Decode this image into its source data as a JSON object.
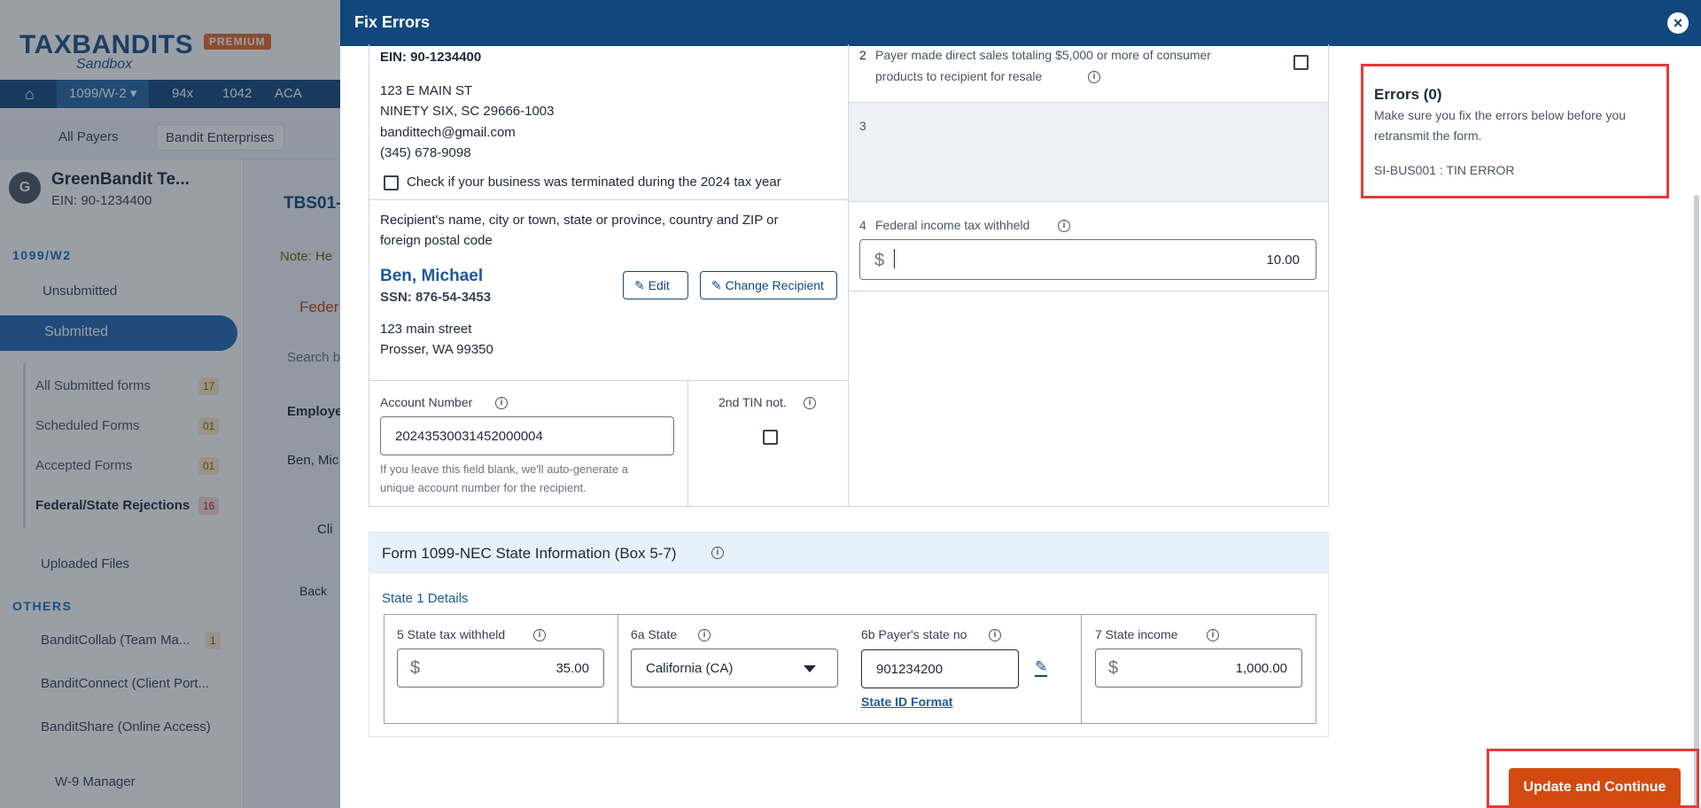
{
  "background": {
    "logo_text": "TAXBANDITS",
    "logo_sub": "Sandbox",
    "logo_badge": "PREMIUM",
    "nav": [
      "1099/W-2 ▾",
      "94x",
      "1042",
      "ACA"
    ],
    "filter_all_payers": "All Payers",
    "filter_chip": "Bandit Enterprises",
    "account": {
      "initial": "G",
      "name": "GreenBandit Te...",
      "ein": "EIN: 90-1234400"
    },
    "section_1099": "1099/W2",
    "unsubmitted": "Unsubmitted",
    "submitted": "Submitted",
    "sub_items": [
      {
        "label": "All Submitted forms",
        "count": "17"
      },
      {
        "label": "Scheduled Forms",
        "count": "01"
      },
      {
        "label": "Accepted Forms",
        "count": "01"
      },
      {
        "label": "Federal/State Rejections",
        "count": "16"
      }
    ],
    "uploaded_files": "Uploaded Files",
    "section_others": "OTHERS",
    "others": [
      {
        "label": "BanditCollab (Team Ma...",
        "count": "1"
      },
      {
        "label": "BanditConnect (Client Port..."
      },
      {
        "label": "BanditShare (Online Access)"
      },
      {
        "label": "W-9 Manager"
      }
    ],
    "main_fragments": {
      "tbs": "TBS01-",
      "note": "Note: He",
      "tab": "Feder",
      "search": "Search b",
      "employee": "Employe",
      "row": "Ben, Mic",
      "toggle_label": "Cli",
      "back": "Back"
    }
  },
  "modal": {
    "title": "Fix Errors",
    "payer": {
      "ein": "EIN: 90-1234400",
      "address1": "123 E MAIN ST",
      "address2": "NINETY SIX, SC 29666-1003",
      "email": "bandittech@gmail.com",
      "phone": "(345) 678-9098",
      "terminated_label": "Check if your business was terminated during the 2024 tax year"
    },
    "box2": {
      "num": "2",
      "label_line1": "Payer made direct sales totaling $5,000 or more of consumer",
      "label_line2": "products to recipient for resale"
    },
    "box3": {
      "num": "3"
    },
    "box4": {
      "num": "4",
      "label": "Federal income tax withheld",
      "currency": "$",
      "value": "10.00"
    },
    "recipient": {
      "heading_line1": "Recipient's name, city or town, state or province, country and ZIP or",
      "heading_line2": "foreign postal code",
      "name": "Ben, Michael",
      "ssn": "SSN: 876-54-3453",
      "edit_label": "Edit",
      "change_label": "Change Recipient",
      "address1": "123 main street",
      "address2": "Prosser, WA 99350"
    },
    "account": {
      "label": "Account Number",
      "value": "20243530031452000004",
      "help_line1": "If you leave this field blank, we'll auto-generate a",
      "help_line2": "unique account number for the recipient."
    },
    "tin": {
      "label": "2nd TIN not."
    },
    "state_section": {
      "title": "Form 1099-NEC  State Information  (Box 5-7)",
      "subtitle": "State 1 Details",
      "box5": {
        "label": "5  State tax withheld",
        "currency": "$",
        "value": "35.00"
      },
      "box6a": {
        "label": "6a  State",
        "value": "California (CA)"
      },
      "box6b": {
        "label": "6b Payer's state no",
        "value": "901234200",
        "link": "State ID Format"
      },
      "box7": {
        "label": "7  State income",
        "currency": "$",
        "value": "1,000.00"
      }
    },
    "errors": {
      "title": "Errors (0)",
      "desc_line1": "Make sure you fix the errors below before you",
      "desc_line2": "retransmit the form.",
      "item": "SI-BUS001 : TIN ERROR"
    },
    "update_button": "Update and Continue"
  }
}
